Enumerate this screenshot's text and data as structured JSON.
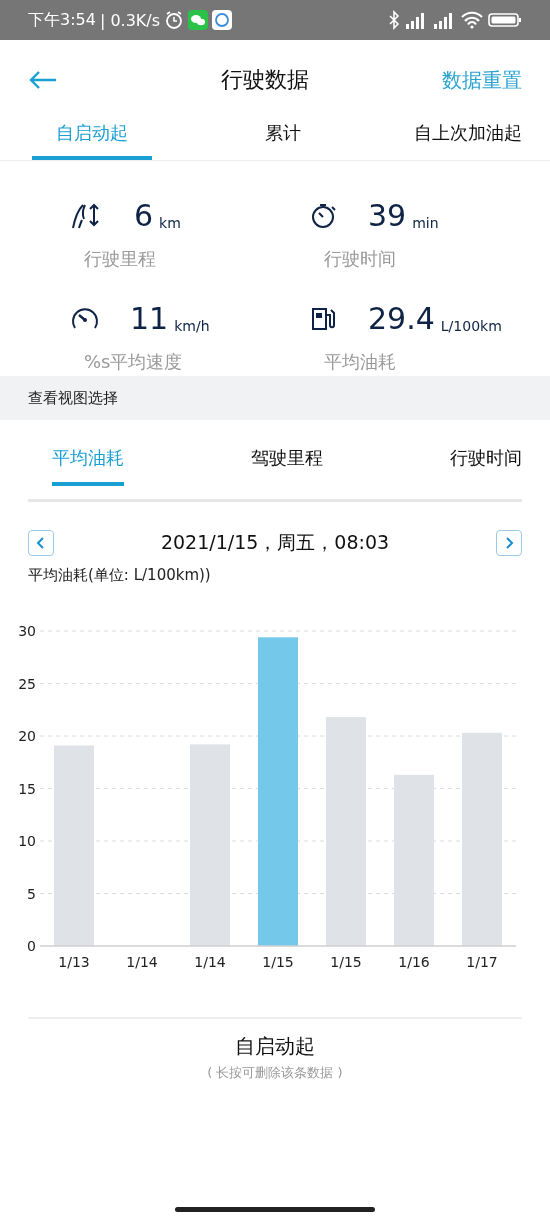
{
  "status_bar": {
    "time": "下午3:54",
    "speed": "| 0.3K/s"
  },
  "header": {
    "title": "行驶数据",
    "action": "数据重置"
  },
  "tabs": [
    {
      "label": "自启动起",
      "selected": true
    },
    {
      "label": "累计",
      "selected": false
    },
    {
      "label": "自上次加油起",
      "selected": false
    }
  ],
  "stats": [
    {
      "kind": "distance",
      "value": "6",
      "unit": "km",
      "label": "行驶里程"
    },
    {
      "kind": "time",
      "value": "39",
      "unit": "min",
      "label": "行驶时间"
    },
    {
      "kind": "speed",
      "value": "11",
      "unit": "km/h",
      "label": "%s平均速度"
    },
    {
      "kind": "fuel",
      "value": "29.4",
      "unit": "L/100km",
      "label": "平均油耗"
    }
  ],
  "view_section": {
    "title": "查看视图选择"
  },
  "view_tabs": [
    {
      "label": "平均油耗",
      "selected": true
    },
    {
      "label": "驾驶里程",
      "selected": false
    },
    {
      "label": "行驶时间",
      "selected": false
    }
  ],
  "date": "2021/1/15，周五，08:03",
  "chart": {
    "chart_data": {
      "type": "bar",
      "title": "平均油耗(单位: L/100km))",
      "categories": [
        "1/13",
        "1/14",
        "1/14",
        "1/15",
        "1/15",
        "1/16",
        "1/17"
      ],
      "series": [
        {
          "color": "#dfe2e6",
          "values": [
            19.1,
            0,
            19.2,
            null,
            21.8,
            16.3,
            20.3
          ]
        },
        {
          "color": "#74c9ea",
          "values": [
            null,
            null,
            null,
            29.4,
            null,
            null,
            null
          ]
        }
      ],
      "stacked": true,
      "grid": true,
      "ylim": [
        0,
        30
      ],
      "yticks": [
        0,
        5,
        10,
        15,
        20,
        25,
        30
      ]
    }
  },
  "footer": {
    "title": "自启动起",
    "hint": "( 长按可删除该条数据 )"
  }
}
